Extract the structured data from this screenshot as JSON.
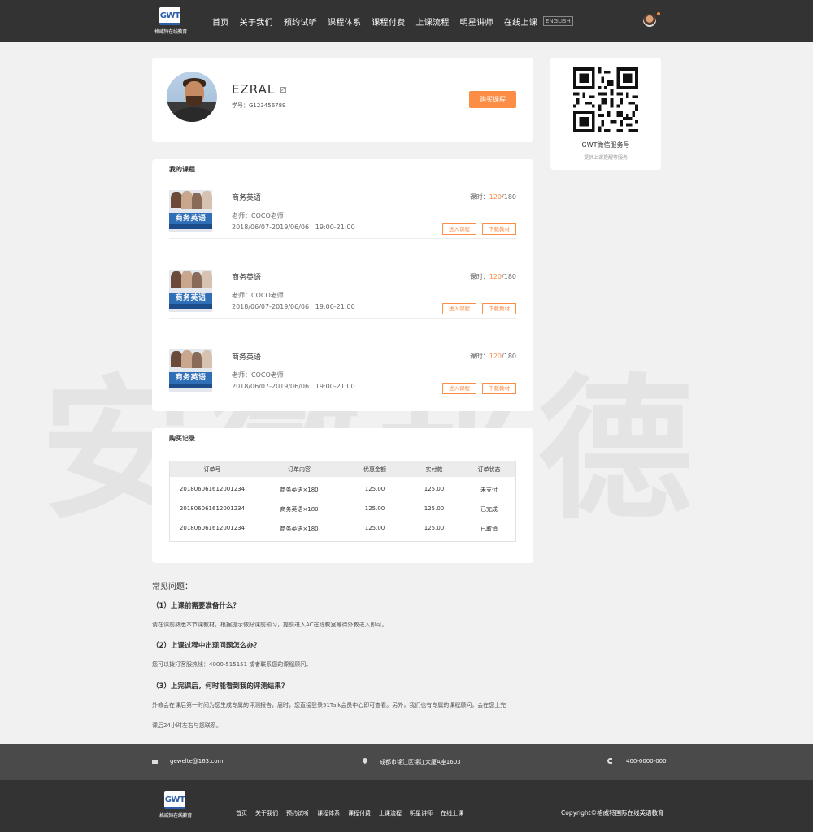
{
  "header": {
    "logo_mark": "GWT",
    "logo_text": "格威特在线教育",
    "nav": [
      "首页",
      "关于我们",
      "预约试听",
      "课程体系",
      "课程付费",
      "上课流程",
      "明星讲师",
      "在线上课"
    ],
    "english": "ENGLISH"
  },
  "profile": {
    "name": "EZRAL",
    "student_id": "学号：G123456789",
    "buy_button": "购买课程"
  },
  "wechat": {
    "title": "GWT微信服务号",
    "subtitle": "提供上课提醒等服务"
  },
  "my_courses": {
    "title": "我的课程",
    "items": [
      {
        "thumb_label": "商务英语",
        "name": "商务英语",
        "teacher": "老师：COCO老师",
        "dates": "2018/06/07-2019/06/06   19:00-21:00",
        "hours_label": "课时：",
        "hours_done": "120",
        "hours_total": "/180",
        "enter_button": "进入课程",
        "download_button": "下载教材"
      },
      {
        "thumb_label": "商务英语",
        "name": "商务英语",
        "teacher": "老师：COCO老师",
        "dates": "2018/06/07-2019/06/06   19:00-21:00",
        "hours_label": "课时：",
        "hours_done": "120",
        "hours_total": "/180",
        "enter_button": "进入课程",
        "download_button": "下载教材"
      },
      {
        "thumb_label": "商务英语",
        "name": "商务英语",
        "teacher": "老师：COCO老师",
        "dates": "2018/06/07-2019/06/06   19:00-21:00",
        "hours_label": "课时：",
        "hours_done": "120",
        "hours_total": "/180",
        "enter_button": "进入课程",
        "download_button": "下载教材"
      }
    ]
  },
  "orders": {
    "title": "购买记录",
    "columns": [
      "订单号",
      "订单内容",
      "优惠金额",
      "实付款",
      "订单状态"
    ],
    "rows": [
      [
        "20180606161200123​4",
        "商务英语×180",
        "125.00",
        "125.00",
        "未支付"
      ],
      [
        "20180606161200123​4",
        "商务英语×180",
        "125.00",
        "125.00",
        "已完成"
      ],
      [
        "20180606161200123​4",
        "商务英语×180",
        "125.00",
        "125.00",
        "已取消"
      ]
    ]
  },
  "faq": {
    "title": "常见问题：",
    "items": [
      {
        "q": "（1）上课前需要准备什么？",
        "a": "请在课前熟悉本节课教材，根据提示做好课前预习，提前进入AC在线教室等待外教进入即可。"
      },
      {
        "q": "（2）上课过程中出现问题怎么办？",
        "a": "您可以拨打客服热线：4000-515151 或者联系您的课程顾问。"
      },
      {
        "q": "（3）上完课后，何时能看到我的评测结果？",
        "a": "外教会在课后第一时间为您生成专属的评测报告，届时，您直接登录51Talk会员中心即可查看。另外，我们也有专属的课程顾问，会在您上完",
        "a2": "课后24小时左右与您联系。"
      }
    ]
  },
  "footer": {
    "email": "gewelte@163.com",
    "address": "成都市锦江区锦江大厦A座1603",
    "phone": "400-0000-000",
    "nav": [
      "首页",
      "关于我们",
      "预约试听",
      "课程体系",
      "课程付费",
      "上课流程",
      "明星讲师",
      "在线上课"
    ],
    "copyright": "Copyright©格威特国际在线英语教育"
  },
  "watermark": "安徽邦德"
}
